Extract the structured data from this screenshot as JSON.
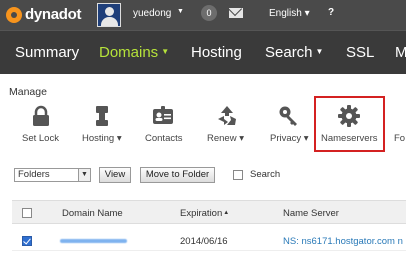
{
  "header": {
    "logo_text": "dynadot",
    "username": "yuedong",
    "user_caret": "▼",
    "notification_count": "0",
    "language": "English ▾",
    "help": "?"
  },
  "nav": {
    "items": [
      {
        "label": "Summary",
        "has_caret": false,
        "active": false
      },
      {
        "label": "Domains",
        "has_caret": true,
        "active": true
      },
      {
        "label": "Hosting",
        "has_caret": false,
        "active": false
      },
      {
        "label": "Search",
        "has_caret": true,
        "active": false
      },
      {
        "label": "SSL",
        "has_caret": false,
        "active": false
      },
      {
        "label": "M",
        "has_caret": false,
        "active": false
      }
    ],
    "caret": "▼",
    "active_color": "#b6e33a"
  },
  "manage": {
    "title": "Manage",
    "tools": [
      {
        "label": "Set Lock",
        "icon": "lock-icon"
      },
      {
        "label": "Hosting ▾",
        "icon": "pipe-icon"
      },
      {
        "label": "Contacts",
        "icon": "contact-card-icon"
      },
      {
        "label": "Renew ▾",
        "icon": "recycle-icon"
      },
      {
        "label": "Privacy ▾",
        "icon": "key-icon"
      },
      {
        "label": "Nameservers",
        "icon": "gear-icon"
      },
      {
        "label": "Fo",
        "icon": "folder-icon"
      }
    ],
    "highlight_color": "#d42121"
  },
  "controls": {
    "folder_select_value": "Folders",
    "view_button": "View",
    "move_button": "Move to Folder",
    "search_label": "Search"
  },
  "table": {
    "columns": [
      "Domain Name",
      "Expiration",
      "Name Server"
    ],
    "sort_indicator": "▲",
    "rows": [
      {
        "domain": "",
        "expiration": "2014/06/16",
        "name_server": "NS: ns6171.hostgator.com n",
        "checked": true
      }
    ]
  }
}
